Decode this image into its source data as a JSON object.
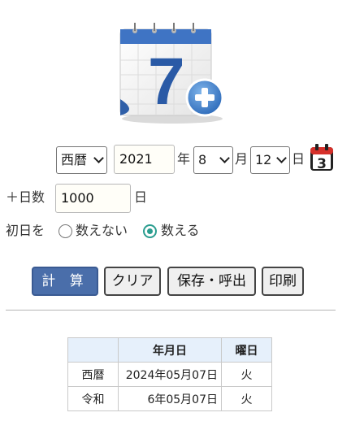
{
  "era_select": {
    "value": "西暦"
  },
  "year": {
    "value": "2021",
    "suffix": "年"
  },
  "month": {
    "value": "8",
    "suffix": "月"
  },
  "day": {
    "value": "12",
    "suffix": "日"
  },
  "calendar_icon_day": "3",
  "add_days": {
    "label": "＋日数",
    "value": "1000",
    "suffix": "日"
  },
  "first_day": {
    "label": "初日を",
    "options": [
      {
        "label": "数えない",
        "checked": false
      },
      {
        "label": "数える",
        "checked": true
      }
    ]
  },
  "buttons": {
    "calc": "計 算",
    "clear": "クリア",
    "save": "保存・呼出",
    "print": "印刷"
  },
  "result_table": {
    "headers": [
      "",
      "年月日",
      "曜日"
    ],
    "rows": [
      {
        "era": "西暦",
        "date": "2024年05月07日",
        "weekday": "火"
      },
      {
        "era": "令和",
        "date": "6年05月07日",
        "weekday": "火"
      }
    ]
  },
  "colors": {
    "primary_button": "#4a6eaa",
    "radio_accent": "#2a9d8f",
    "calendar_icon_red": "#d6302a"
  },
  "logo": {
    "digit": "7",
    "plus": "+"
  }
}
